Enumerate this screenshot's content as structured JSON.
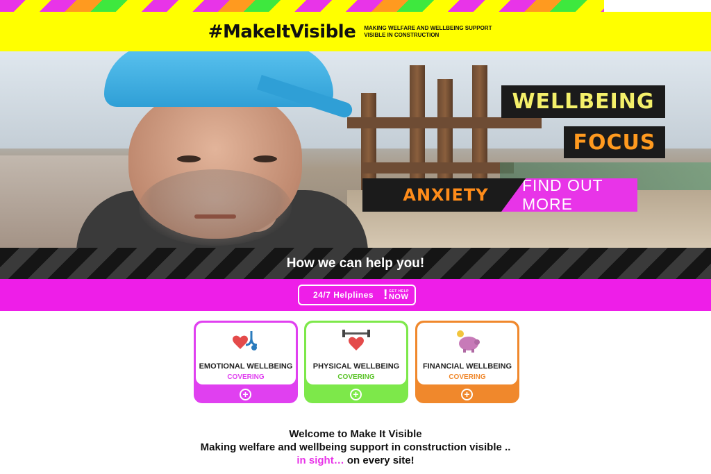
{
  "header": {
    "brand": "#MakeItVisible",
    "tagline": "MAKING WELFARE AND WELLBEING SUPPORT VISIBLE IN CONSTRUCTION"
  },
  "hero": {
    "tag_line1": "WELLBEING",
    "tag_line2": "FOCUS",
    "topic": "ANXIETY",
    "cta_label": "FIND OUT MORE"
  },
  "help_section": {
    "heading": "How we can help you!",
    "helpline_label": "24/7 Helplines",
    "badge_small": "GET HELP",
    "badge_now": "NOW"
  },
  "cards": [
    {
      "title": "EMOTIONAL WELLBEING",
      "subtitle": "COVERING",
      "icon": "stethoscope-heart-icon",
      "color": "#e040f0"
    },
    {
      "title": "PHYSICAL WELLBEING",
      "subtitle": "COVERING",
      "icon": "heart-dumbbell-icon",
      "color": "#7de84a"
    },
    {
      "title": "FINANCIAL WELLBEING",
      "subtitle": "COVERING",
      "icon": "piggy-bank-icon",
      "color": "#f0882c"
    }
  ],
  "welcome": {
    "line1": "Welcome to Make It Visible",
    "line2": "Making welfare and wellbeing support in construction visible ..",
    "line3_highlight": "in sight…",
    "line3_rest": " on every site!"
  },
  "colors": {
    "yellow": "#ffff00",
    "magenta": "#ee1ee8",
    "green": "#7de84a",
    "orange": "#f0882c"
  }
}
